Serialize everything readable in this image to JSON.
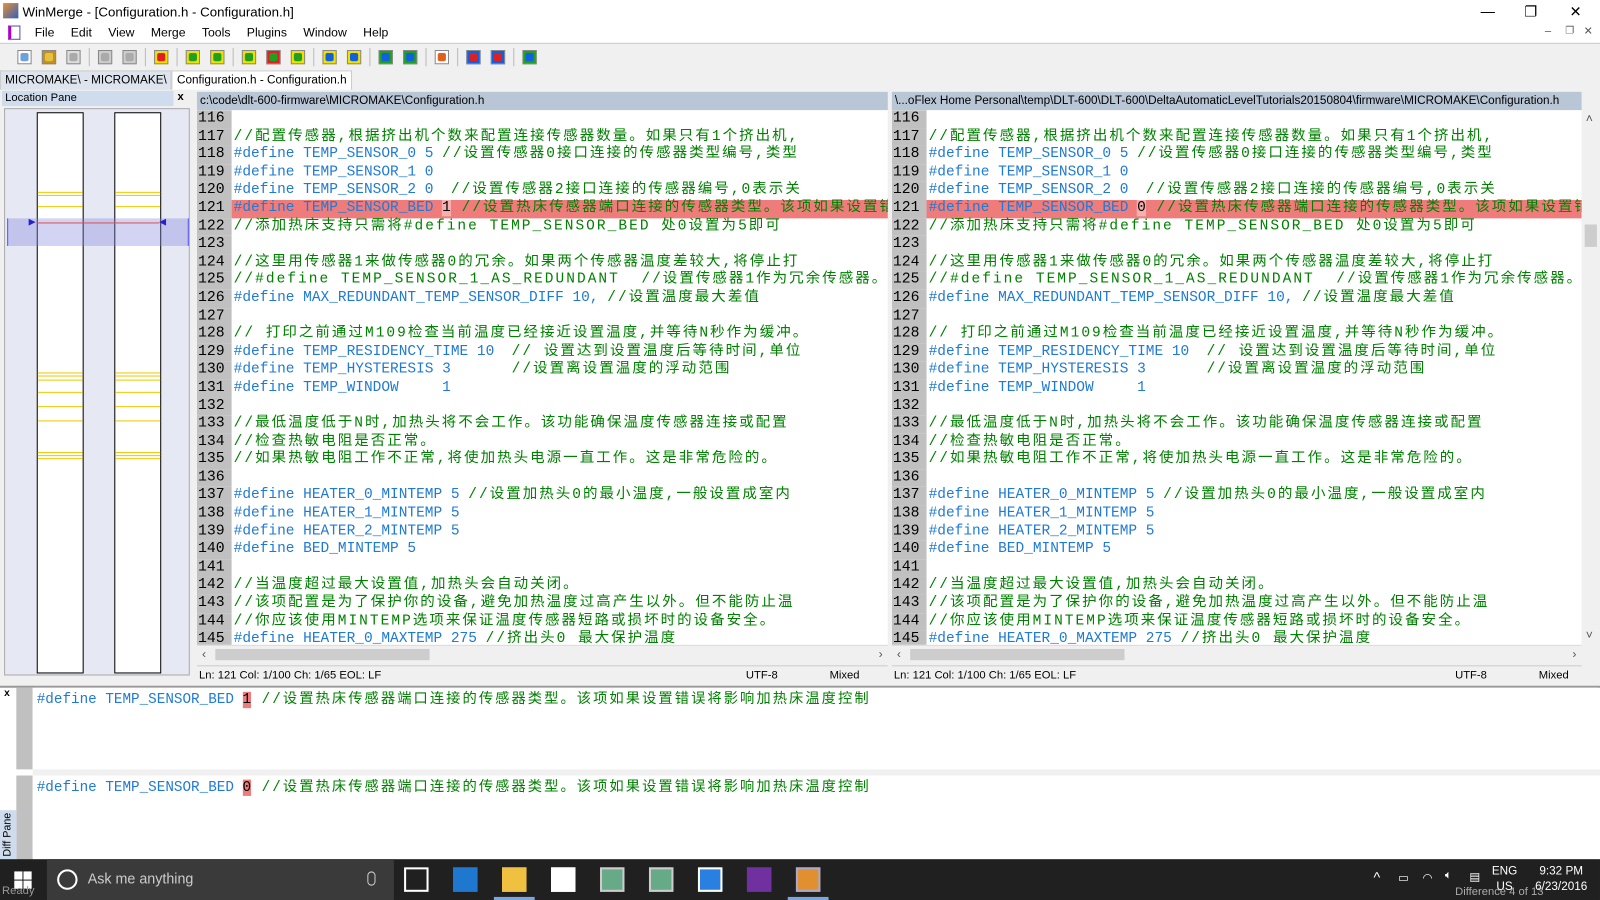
{
  "window": {
    "title": "WinMerge - [Configuration.h - Configuration.h]",
    "minimize": "—",
    "restore": "❐",
    "close": "✕"
  },
  "menu": [
    "File",
    "Edit",
    "View",
    "Merge",
    "Tools",
    "Plugins",
    "Window",
    "Help"
  ],
  "toolbar_icons": [
    "new-icon",
    "open-icon",
    "save-icon",
    "undo-icon",
    "redo-icon",
    "select-diff-icon",
    "next-diff-icon",
    "prev-diff-icon",
    "first-diff-icon",
    "current-diff-icon",
    "last-diff-icon",
    "copy-right-icon",
    "copy-left-icon",
    "copy-right-advance-icon",
    "copy-left-advance-icon",
    "options-icon",
    "all-right-icon",
    "all-left-icon",
    "refresh-icon"
  ],
  "tabs": [
    {
      "label": "MICROMAKE\\ - MICROMAKE\\"
    },
    {
      "label": "Configuration.h - Configuration.h"
    }
  ],
  "location_pane": {
    "title": "Location Pane",
    "close": "x"
  },
  "left": {
    "path": "c:\\code\\dlt-600-firmware\\MICROMAKE\\Configuration.h",
    "diff_value": "1",
    "status": {
      "pos": "Ln: 121  Col: 1/100  Ch: 1/65  EOL: LF",
      "encoding": "UTF-8",
      "eol_mode": "Mixed"
    }
  },
  "right": {
    "path": "\\...oFlex Home Personal\\temp\\DLT-600\\DLT-600\\DeltaAutomaticLevelTutorials20150804\\firmware\\MICROMAKE\\Configuration.h",
    "diff_value": "0",
    "status": {
      "pos": "Ln: 121  Col: 1/100  Ch: 1/65  EOL: LF",
      "encoding": "UTF-8",
      "eol_mode": "Mixed"
    }
  },
  "lines": [
    {
      "n": "116",
      "code": "",
      "comment": ""
    },
    {
      "n": "117",
      "code": "",
      "comment": "//配置传感器,根据挤出机个数来配置连接传感器数量。如果只有1个挤出机,"
    },
    {
      "n": "118",
      "code": "#define TEMP_SENSOR_0 5 ",
      "comment": "//设置传感器0接口连接的传感器类型编号,类型"
    },
    {
      "n": "119",
      "code": "#define TEMP_SENSOR_1 0",
      "comment": ""
    },
    {
      "n": "120",
      "code": "#define TEMP_SENSOR_2 0  ",
      "comment": "//设置传感器2接口连接的传感器编号,0表示关"
    },
    {
      "n": "121",
      "code": "#define TEMP_SENSOR_BED ",
      "comment": " //设置热床传感器端口连接的传感器类型。该项如果设置错误将影响加热床温度控制",
      "diff": true
    },
    {
      "n": "122",
      "code": "",
      "comment": "//添加热床支持只需将#define TEMP_SENSOR_BED 处0设置为5即可"
    },
    {
      "n": "123",
      "code": "",
      "comment": ""
    },
    {
      "n": "124",
      "code": "",
      "comment": "//这里用传感器1来做传感器0的冗余。如果两个传感器温度差较大,将停止打"
    },
    {
      "n": "125",
      "code": "",
      "comment": "//#define TEMP_SENSOR_1_AS_REDUNDANT  //设置传感器1作为冗余传感器。"
    },
    {
      "n": "126",
      "code": "#define MAX_REDUNDANT_TEMP_SENSOR_DIFF 10, ",
      "comment": "//设置温度最大差值"
    },
    {
      "n": "127",
      "code": "",
      "comment": ""
    },
    {
      "n": "128",
      "code": "",
      "comment": "// 打印之前通过M109检查当前温度已经接近设置温度,并等待N秒作为缓冲。"
    },
    {
      "n": "129",
      "code": "#define TEMP_RESIDENCY_TIME 10  ",
      "comment": "// 设置达到设置温度后等待时间,单位"
    },
    {
      "n": "130",
      "code": "#define TEMP_HYSTERESIS 3       ",
      "comment": "//设置离设置温度的浮动范围"
    },
    {
      "n": "131",
      "code": "#define TEMP_WINDOW     1",
      "comment": ""
    },
    {
      "n": "132",
      "code": "",
      "comment": ""
    },
    {
      "n": "133",
      "code": "",
      "comment": "//最低温度低于N时,加热头将不会工作。该功能确保温度传感器连接或配置"
    },
    {
      "n": "134",
      "code": "",
      "comment": "//检查热敏电阻是否正常。"
    },
    {
      "n": "135",
      "code": "",
      "comment": "//如果热敏电阻工作不正常,将使加热头电源一直工作。这是非常危险的。"
    },
    {
      "n": "136",
      "code": "",
      "comment": ""
    },
    {
      "n": "137",
      "code": "#define HEATER_0_MINTEMP 5 ",
      "comment": "//设置加热头0的最小温度,一般设置成室内"
    },
    {
      "n": "138",
      "code": "#define HEATER_1_MINTEMP 5",
      "comment": ""
    },
    {
      "n": "139",
      "code": "#define HEATER_2_MINTEMP 5",
      "comment": ""
    },
    {
      "n": "140",
      "code": "#define BED_MINTEMP 5",
      "comment": ""
    },
    {
      "n": "141",
      "code": "",
      "comment": ""
    },
    {
      "n": "142",
      "code": "",
      "comment": "//当温度超过最大设置值,加热头会自动关闭。"
    },
    {
      "n": "143",
      "code": "",
      "comment": "//该项配置是为了保护你的设备,避免加热温度过高产生以外。但不能防止温"
    },
    {
      "n": "144",
      "code": "",
      "comment": "//你应该使用MINTEMP选项来保证温度传感器短路或损坏时的设备安全。"
    },
    {
      "n": "145",
      "code": "#define HEATER_0_MAXTEMP 275 ",
      "comment": "//挤出头0 最大保护温度"
    }
  ],
  "diff_pane": {
    "label": "Diff Pane",
    "close": "x",
    "code": "#define TEMP_SENSOR_BED ",
    "comment": " //设置热床传感器端口连接的传感器类型。该项如果设置错误将影响加热床温度控制"
  },
  "statusbar": {
    "ready": "Ready",
    "difference": "Difference 4 of 13"
  },
  "taskbar": {
    "search_placeholder": "Ask me anything",
    "lang1": "ENG",
    "lang2": "US",
    "time": "9:32 PM",
    "date": "6/23/2016"
  },
  "colors": {
    "diff_line": "#ef7b7b",
    "diff_char": "#f7b0b0",
    "moved_marker": "#f0c800",
    "code": "#1f7ad4",
    "comment": "#008000"
  }
}
